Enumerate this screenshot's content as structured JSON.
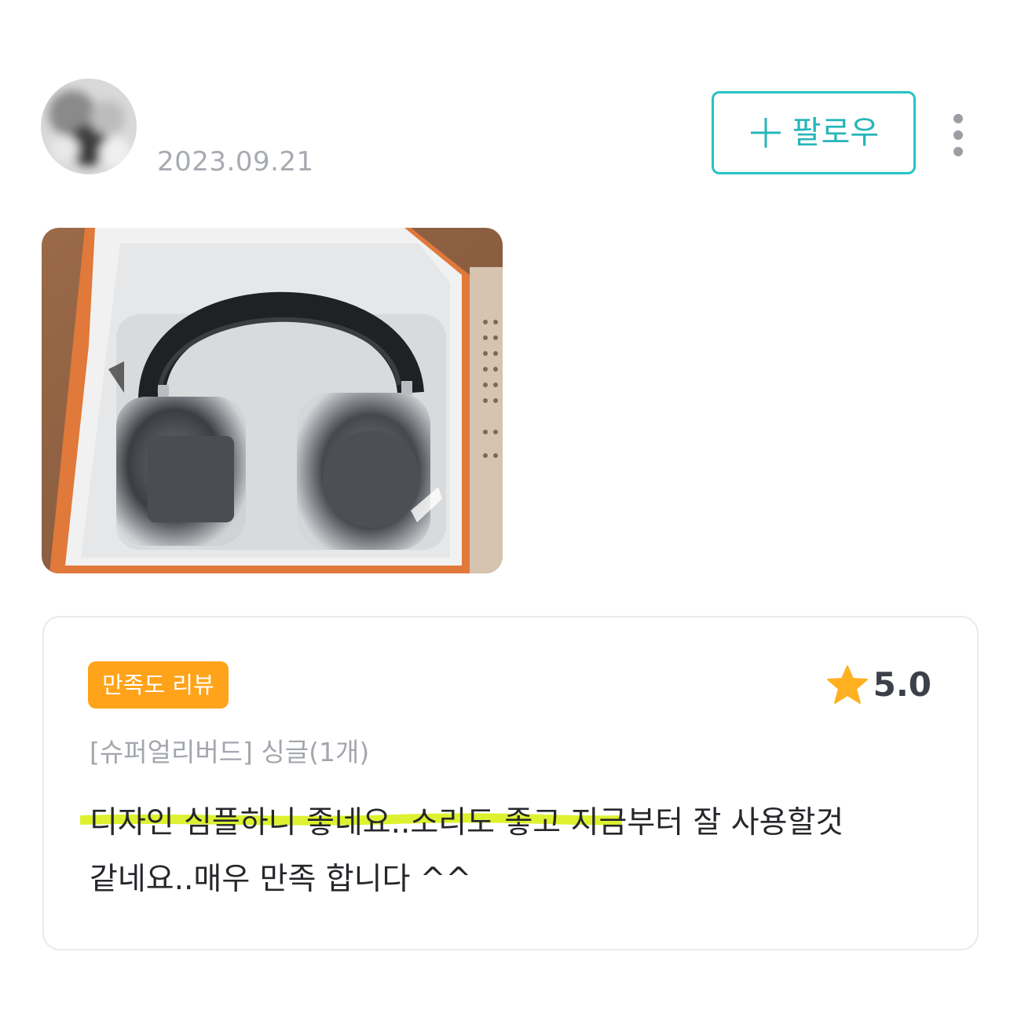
{
  "header": {
    "date": "2023.09.21",
    "follow_label": "팔로우"
  },
  "icons": {
    "avatar": "avatar-blurred",
    "follow": "plus-icon",
    "more": "kebab-menu-icon",
    "star": "star-icon"
  },
  "colors": {
    "accent": "#27c3c6",
    "badge": "#ffa31a",
    "star": "#ffb020",
    "highlight": "#d9f01a"
  },
  "review": {
    "badge": "만족도 리뷰",
    "rating": "5.0",
    "option": "[슈퍼얼리버드] 싱글(1개)",
    "text_line1": "디자인 심플하니 좋네요..소리도 좋고 지금부터 잘 사용할것",
    "text_line2": "같네요..매우 만족 합니다 ^^"
  }
}
